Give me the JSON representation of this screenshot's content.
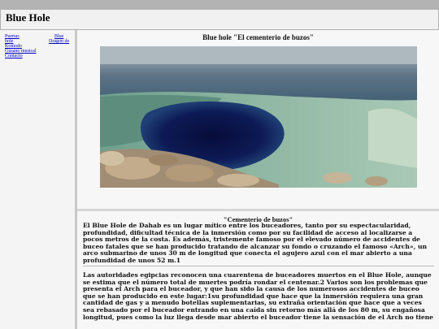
{
  "site": {
    "title": "Blue Hole"
  },
  "sidebar": {
    "items": [
      {
        "label": "Puertas"
      },
      {
        "label": "hole"
      },
      {
        "label": "Komodo"
      },
      {
        "label": "Gusano musical"
      },
      {
        "label": "Contacto"
      },
      {
        "label": "Blue"
      },
      {
        "label": "Dragon de"
      }
    ]
  },
  "main": {
    "headline": "Blue hole \"El cementerio de buzos\"",
    "image_alt": "Blue Hole de Dahab",
    "subtitle": "\"Cementerio de buzos\"",
    "paragraphs": [
      "El Blue Hole de Dahab es un lugar mítico entre los buceadores, tanto por su espectacularidad, profundidad, dificultad técnica de la inmersión como por su facilidad de acceso al localizarse a pocos metros de la costa. Es además, tristemente famoso por el elevado número de accidentes de buceo fatales que se han producido tratando de alcanzar su fondo o cruzando el famoso «Arch», un arco submarino de unos 30 m de longitud que conecta el agujero azul con el mar abierto a una profundidad de unos 52 m.1",
      "Las autoridades egipcias reconocen una cuarentena de buceadores muertos en el Blue Hole, aunque se estima que el número total de muertes podría rondar el centenar.2 Varios son los problemas que presenta el Arch para el buceador, y que han sido la causa de los numerosos accidentes de buceo que se han producido en este lugar:1su profundidad que hace que la inmersión requiera una gran cantidad de gas y a menudo botellas suplementarias, su extraña orientación que hace que a veces sea rebasado por el buceador entrando en una caída sin retorno más allá de los 80 m, su engañosa longitud, pues como la luz llega desde mar abierto el buceador tiene la sensación de el Arch no tiene"
    ]
  }
}
